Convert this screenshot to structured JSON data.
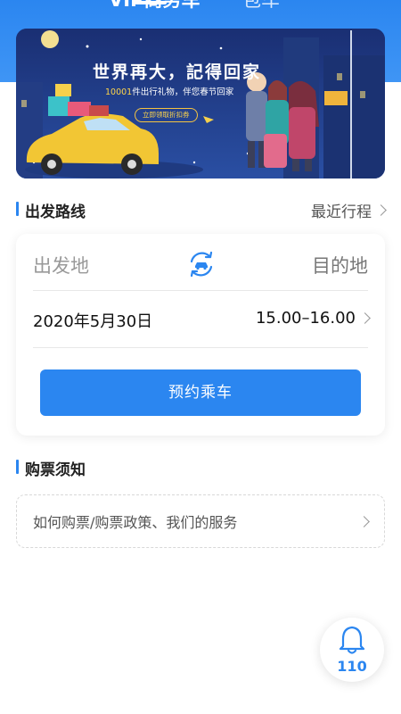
{
  "tabs": [
    {
      "label": "VIP商务车",
      "active": true
    },
    {
      "label": "包车",
      "active": false
    }
  ],
  "banner": {
    "title": "世界再大，記得回家",
    "subtitle_highlight": "10001",
    "subtitle_rest": "件出行礼物，伴您春节回家",
    "button_label": "立即领取折扣券"
  },
  "route_section": {
    "title": "出发路线",
    "recent_label": "最近行程"
  },
  "route_card": {
    "from_placeholder": "出发地",
    "to_placeholder": "目的地",
    "date": "2020年5月30日",
    "time_range": "15.00–16.00",
    "book_button": "预约乘车"
  },
  "ticket_section": {
    "title": "购票须知",
    "notice_text": "如何购票/购票政策、我们的服务"
  },
  "sos": {
    "number": "110"
  },
  "colors": {
    "primary": "#2b86f0",
    "banner_bg": "#1d3b86",
    "accent_yellow": "#ffd54a"
  },
  "icons": [
    "swap-car-icon",
    "chevron-right-icon",
    "bell-icon"
  ]
}
